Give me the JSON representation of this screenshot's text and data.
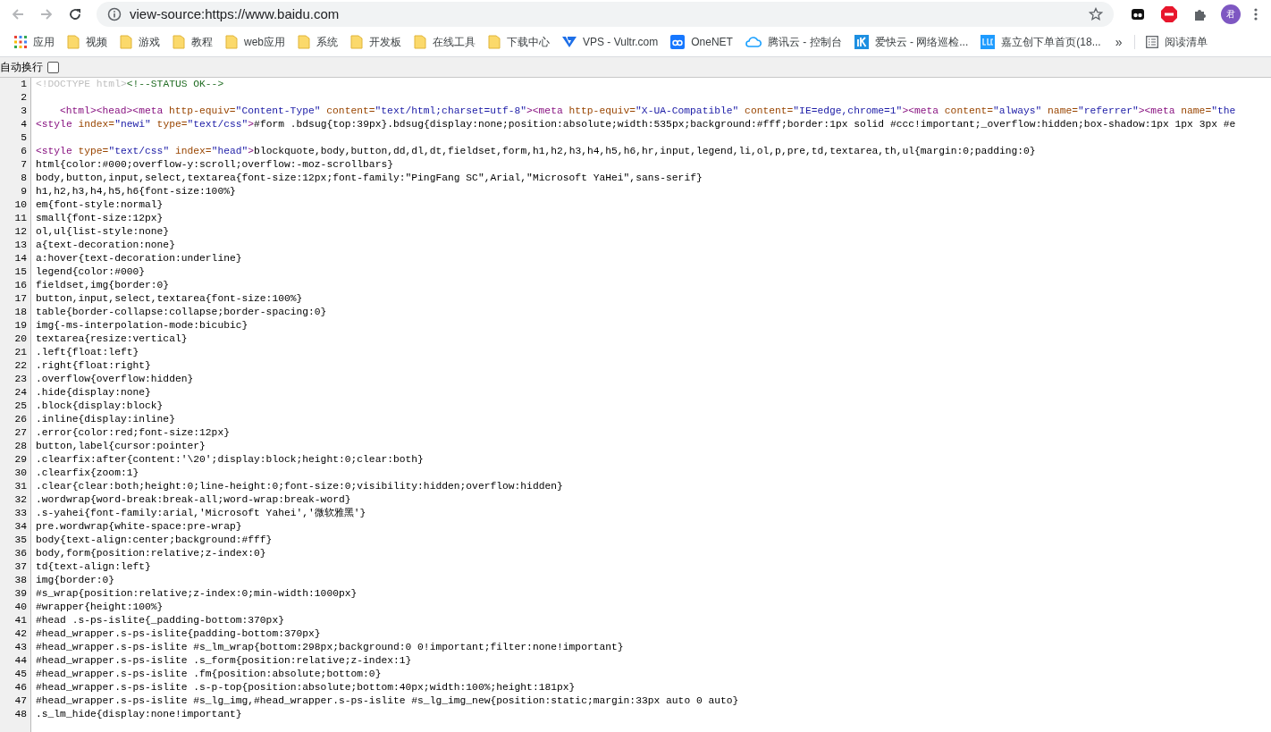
{
  "toolbar": {
    "back_disabled": true,
    "forward_disabled": true,
    "url": "view-source:https://www.baidu.com",
    "avatar": "君"
  },
  "bookmarks": [
    {
      "label": "应用",
      "kind": "apps"
    },
    {
      "label": "视频",
      "kind": "folder"
    },
    {
      "label": "游戏",
      "kind": "folder"
    },
    {
      "label": "教程",
      "kind": "folder"
    },
    {
      "label": "web应用",
      "kind": "folder"
    },
    {
      "label": "系统",
      "kind": "folder"
    },
    {
      "label": "开发板",
      "kind": "folder"
    },
    {
      "label": "在线工具",
      "kind": "folder"
    },
    {
      "label": "下载中心",
      "kind": "folder"
    },
    {
      "label": "VPS - Vultr.com",
      "kind": "vultr"
    },
    {
      "label": "OneNET",
      "kind": "onenet"
    },
    {
      "label": "腾讯云 - 控制台",
      "kind": "cloud"
    },
    {
      "label": "爱快云 - 网络巡检...",
      "kind": "ikuai"
    },
    {
      "label": "嘉立创下单首页(18...",
      "kind": "jlc"
    }
  ],
  "bookmarks_overflow": "»",
  "reading_list": "阅读清单",
  "wrap_toggle": {
    "label": "自动换行",
    "checked": false
  },
  "source_lines": [
    {
      "number": "1",
      "segments": [
        {
          "kind": "doctype",
          "text": "<!DOCTYPE html>"
        },
        {
          "kind": "comment",
          "text": "<!--STATUS OK-->"
        }
      ]
    },
    {
      "number": "2"
    },
    {
      "number": "3",
      "indented": true,
      "segments": [
        {
          "kind": "tag",
          "text": "<html><head><meta "
        },
        {
          "kind": "attr",
          "text": "http-equiv="
        },
        {
          "kind": "value",
          "text": "\"Content-Type\""
        },
        {
          "kind": "attr",
          "text": " content="
        },
        {
          "kind": "value",
          "text": "\"text/html;charset=utf-8\""
        },
        {
          "kind": "tag",
          "text": "><meta "
        },
        {
          "kind": "attr",
          "text": "http-equiv="
        },
        {
          "kind": "value",
          "text": "\"X-UA-Compatible\""
        },
        {
          "kind": "attr",
          "text": " content="
        },
        {
          "kind": "value",
          "text": "\"IE=edge,chrome=1\""
        },
        {
          "kind": "tag",
          "text": "><meta "
        },
        {
          "kind": "attr",
          "text": "content="
        },
        {
          "kind": "value",
          "text": "\"always\""
        },
        {
          "kind": "attr",
          "text": " name="
        },
        {
          "kind": "value",
          "text": "\"referrer\""
        },
        {
          "kind": "tag",
          "text": "><meta "
        },
        {
          "kind": "attr",
          "text": "name="
        },
        {
          "kind": "value",
          "text": "\"the"
        }
      ]
    },
    {
      "number": "4",
      "segments": [
        {
          "kind": "tag",
          "text": "<style "
        },
        {
          "kind": "attr",
          "text": "index="
        },
        {
          "kind": "value",
          "text": "\"newi\""
        },
        {
          "kind": "attr",
          "text": " type="
        },
        {
          "kind": "value",
          "text": "\"text/css\""
        },
        {
          "kind": "tag",
          "text": ">"
        },
        {
          "kind": "text",
          "text": "#form .bdsug{top:39px}.bdsug{display:none;position:absolute;width:535px;background:#fff;border:1px solid #ccc!important;_overflow:hidden;box-shadow:1px 1px 3px #e"
        }
      ]
    },
    {
      "number": "5"
    },
    {
      "number": "6",
      "segments": [
        {
          "kind": "tag",
          "text": "<style "
        },
        {
          "kind": "attr",
          "text": "type="
        },
        {
          "kind": "value",
          "text": "\"text/css\""
        },
        {
          "kind": "attr",
          "text": " index="
        },
        {
          "kind": "value",
          "text": "\"head\""
        },
        {
          "kind": "tag",
          "text": ">"
        },
        {
          "kind": "text",
          "text": "blockquote,body,button,dd,dl,dt,fieldset,form,h1,h2,h3,h4,h5,h6,hr,input,legend,li,ol,p,pre,td,textarea,th,ul{margin:0;padding:0}"
        }
      ]
    },
    {
      "number": "7",
      "segments": [
        {
          "kind": "text",
          "text": "html{color:#000;overflow-y:scroll;overflow:-moz-scrollbars}"
        }
      ]
    },
    {
      "number": "8",
      "segments": [
        {
          "kind": "text",
          "text": "body,button,input,select,textarea{font-size:12px;font-family:\"PingFang SC\",Arial,\"Microsoft YaHei\",sans-serif}"
        }
      ]
    },
    {
      "number": "9",
      "segments": [
        {
          "kind": "text",
          "text": "h1,h2,h3,h4,h5,h6{font-size:100%}"
        }
      ]
    },
    {
      "number": "10",
      "segments": [
        {
          "kind": "text",
          "text": "em{font-style:normal}"
        }
      ]
    },
    {
      "number": "11",
      "segments": [
        {
          "kind": "text",
          "text": "small{font-size:12px}"
        }
      ]
    },
    {
      "number": "12",
      "segments": [
        {
          "kind": "text",
          "text": "ol,ul{list-style:none}"
        }
      ]
    },
    {
      "number": "13",
      "segments": [
        {
          "kind": "text",
          "text": "a{text-decoration:none}"
        }
      ]
    },
    {
      "number": "14",
      "segments": [
        {
          "kind": "text",
          "text": "a:hover{text-decoration:underline}"
        }
      ]
    },
    {
      "number": "15",
      "segments": [
        {
          "kind": "text",
          "text": "legend{color:#000}"
        }
      ]
    },
    {
      "number": "16",
      "segments": [
        {
          "kind": "text",
          "text": "fieldset,img{border:0}"
        }
      ]
    },
    {
      "number": "17",
      "segments": [
        {
          "kind": "text",
          "text": "button,input,select,textarea{font-size:100%}"
        }
      ]
    },
    {
      "number": "18",
      "segments": [
        {
          "kind": "text",
          "text": "table{border-collapse:collapse;border-spacing:0}"
        }
      ]
    },
    {
      "number": "19",
      "segments": [
        {
          "kind": "text",
          "text": "img{-ms-interpolation-mode:bicubic}"
        }
      ]
    },
    {
      "number": "20",
      "segments": [
        {
          "kind": "text",
          "text": "textarea{resize:vertical}"
        }
      ]
    },
    {
      "number": "21",
      "segments": [
        {
          "kind": "text",
          "text": ".left{float:left}"
        }
      ]
    },
    {
      "number": "22",
      "segments": [
        {
          "kind": "text",
          "text": ".right{float:right}"
        }
      ]
    },
    {
      "number": "23",
      "segments": [
        {
          "kind": "text",
          "text": ".overflow{overflow:hidden}"
        }
      ]
    },
    {
      "number": "24",
      "segments": [
        {
          "kind": "text",
          "text": ".hide{display:none}"
        }
      ]
    },
    {
      "number": "25",
      "segments": [
        {
          "kind": "text",
          "text": ".block{display:block}"
        }
      ]
    },
    {
      "number": "26",
      "segments": [
        {
          "kind": "text",
          "text": ".inline{display:inline}"
        }
      ]
    },
    {
      "number": "27",
      "segments": [
        {
          "kind": "text",
          "text": ".error{color:red;font-size:12px}"
        }
      ]
    },
    {
      "number": "28",
      "segments": [
        {
          "kind": "text",
          "text": "button,label{cursor:pointer}"
        }
      ]
    },
    {
      "number": "29",
      "segments": [
        {
          "kind": "text",
          "text": ".clearfix:after{content:'\\20';display:block;height:0;clear:both}"
        }
      ]
    },
    {
      "number": "30",
      "segments": [
        {
          "kind": "text",
          "text": ".clearfix{zoom:1}"
        }
      ]
    },
    {
      "number": "31",
      "segments": [
        {
          "kind": "text",
          "text": ".clear{clear:both;height:0;line-height:0;font-size:0;visibility:hidden;overflow:hidden}"
        }
      ]
    },
    {
      "number": "32",
      "segments": [
        {
          "kind": "text",
          "text": ".wordwrap{word-break:break-all;word-wrap:break-word}"
        }
      ]
    },
    {
      "number": "33",
      "segments": [
        {
          "kind": "text",
          "text": ".s-yahei{font-family:arial,'Microsoft Yahei','微软雅黑'}"
        }
      ]
    },
    {
      "number": "34",
      "segments": [
        {
          "kind": "text",
          "text": "pre.wordwrap{white-space:pre-wrap}"
        }
      ]
    },
    {
      "number": "35",
      "segments": [
        {
          "kind": "text",
          "text": "body{text-align:center;background:#fff}"
        }
      ]
    },
    {
      "number": "36",
      "segments": [
        {
          "kind": "text",
          "text": "body,form{position:relative;z-index:0}"
        }
      ]
    },
    {
      "number": "37",
      "segments": [
        {
          "kind": "text",
          "text": "td{text-align:left}"
        }
      ]
    },
    {
      "number": "38",
      "segments": [
        {
          "kind": "text",
          "text": "img{border:0}"
        }
      ]
    },
    {
      "number": "39",
      "segments": [
        {
          "kind": "text",
          "text": "#s_wrap{position:relative;z-index:0;min-width:1000px}"
        }
      ]
    },
    {
      "number": "40",
      "segments": [
        {
          "kind": "text",
          "text": "#wrapper{height:100%}"
        }
      ]
    },
    {
      "number": "41",
      "segments": [
        {
          "kind": "text",
          "text": "#head .s-ps-islite{_padding-bottom:370px}"
        }
      ]
    },
    {
      "number": "42",
      "segments": [
        {
          "kind": "text",
          "text": "#head_wrapper.s-ps-islite{padding-bottom:370px}"
        }
      ]
    },
    {
      "number": "43",
      "segments": [
        {
          "kind": "text",
          "text": "#head_wrapper.s-ps-islite #s_lm_wrap{bottom:298px;background:0 0!important;filter:none!important}"
        }
      ]
    },
    {
      "number": "44",
      "segments": [
        {
          "kind": "text",
          "text": "#head_wrapper.s-ps-islite .s_form{position:relative;z-index:1}"
        }
      ]
    },
    {
      "number": "45",
      "segments": [
        {
          "kind": "text",
          "text": "#head_wrapper.s-ps-islite .fm{position:absolute;bottom:0}"
        }
      ]
    },
    {
      "number": "46",
      "segments": [
        {
          "kind": "text",
          "text": "#head_wrapper.s-ps-islite .s-p-top{position:absolute;bottom:40px;width:100%;height:181px}"
        }
      ]
    },
    {
      "number": "47",
      "segments": [
        {
          "kind": "text",
          "text": "#head_wrapper.s-ps-islite #s_lg_img,#head_wrapper.s-ps-islite #s_lg_img_new{position:static;margin:33px auto 0 auto}"
        }
      ]
    },
    {
      "number": "48",
      "segments": [
        {
          "kind": "text",
          "text": ".s_lm_hide{display:none!important}"
        }
      ]
    }
  ]
}
